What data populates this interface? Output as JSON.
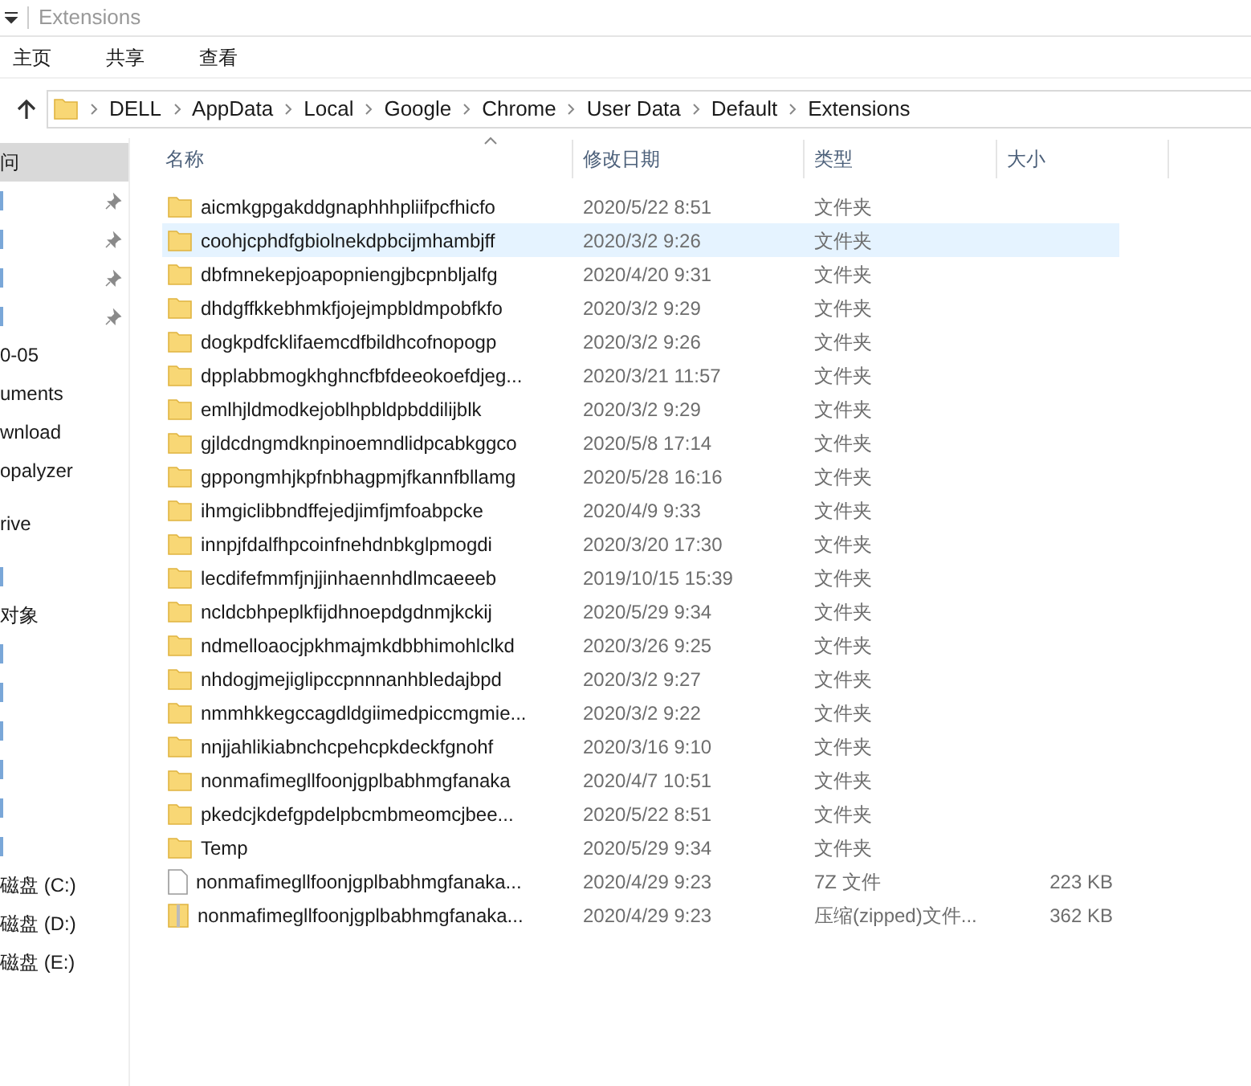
{
  "window": {
    "title": "Extensions"
  },
  "ribbon_tabs": [
    {
      "label": "主页",
      "selected": false
    },
    {
      "label": "共享",
      "selected": false
    },
    {
      "label": "查看",
      "selected": false
    }
  ],
  "address_bar": {
    "path": [
      "DELL",
      "AppData",
      "Local",
      "Google",
      "Chrome",
      "User Data",
      "Default",
      "Extensions"
    ]
  },
  "sidebar": {
    "items": [
      {
        "kind": "text",
        "label": "问",
        "selected": true,
        "pinned": false
      },
      {
        "kind": "fragment",
        "selected": false,
        "pinned": true
      },
      {
        "kind": "fragment",
        "selected": false,
        "pinned": true
      },
      {
        "kind": "fragment",
        "selected": false,
        "pinned": true
      },
      {
        "kind": "fragment",
        "selected": false,
        "pinned": true
      },
      {
        "kind": "text",
        "label": "0-05",
        "selected": false,
        "pinned": false
      },
      {
        "kind": "text",
        "label": "uments",
        "selected": false,
        "pinned": false
      },
      {
        "kind": "text",
        "label": "wnload",
        "selected": false,
        "pinned": false
      },
      {
        "kind": "text",
        "label": "opalyzer",
        "selected": false,
        "pinned": false
      },
      {
        "kind": "gap"
      },
      {
        "kind": "text",
        "label": "rive",
        "selected": false,
        "pinned": false
      },
      {
        "kind": "gap"
      },
      {
        "kind": "fragment",
        "selected": false,
        "pinned": false
      },
      {
        "kind": "text",
        "label": "对象",
        "selected": false,
        "pinned": false
      },
      {
        "kind": "fragment",
        "selected": false,
        "pinned": false
      },
      {
        "kind": "fragment",
        "selected": false,
        "pinned": false
      },
      {
        "kind": "fragment",
        "selected": false,
        "pinned": false
      },
      {
        "kind": "fragment",
        "selected": false,
        "pinned": false
      },
      {
        "kind": "fragment",
        "selected": false,
        "pinned": false
      },
      {
        "kind": "fragment",
        "selected": false,
        "pinned": false
      },
      {
        "kind": "text",
        "label": "磁盘 (C:)",
        "selected": false,
        "pinned": false
      },
      {
        "kind": "text",
        "label": "磁盘 (D:)",
        "selected": false,
        "pinned": false
      },
      {
        "kind": "text",
        "label": "磁盘 (E:)",
        "selected": false,
        "pinned": false
      }
    ]
  },
  "table": {
    "columns": [
      "名称",
      "修改日期",
      "类型",
      "大小"
    ],
    "rows": [
      {
        "kind": "folder",
        "name": "aicmkgpgakddgnaphhhpliifpcfhicfo",
        "date": "2020/5/22 8:51",
        "type": "文件夹",
        "selected": false
      },
      {
        "kind": "folder",
        "name": "coohjcphdfgbiolnekdpbcijmhambjff",
        "date": "2020/3/2 9:26",
        "type": "文件夹",
        "selected": true
      },
      {
        "kind": "folder",
        "name": "dbfmnekepjoapopniengjbcpnbljalfg",
        "date": "2020/4/20 9:31",
        "type": "文件夹",
        "selected": false
      },
      {
        "kind": "folder",
        "name": "dhdgffkkebhmkfjojejmpbldmpobfkfo",
        "date": "2020/3/2 9:29",
        "type": "文件夹",
        "selected": false
      },
      {
        "kind": "folder",
        "name": "dogkpdfcklifaemcdfbildhcofnopogp",
        "date": "2020/3/2 9:26",
        "type": "文件夹",
        "selected": false
      },
      {
        "kind": "folder",
        "name": "dpplabbmogkhghncfbfdeeokoefdjeg...",
        "date": "2020/3/21 11:57",
        "type": "文件夹",
        "selected": false
      },
      {
        "kind": "folder",
        "name": "emlhjldmodkejoblhpbldpbddilijblk",
        "date": "2020/3/2 9:29",
        "type": "文件夹",
        "selected": false
      },
      {
        "kind": "folder",
        "name": "gjldcdngmdknpinoemndlidpcabkggco",
        "date": "2020/5/8 17:14",
        "type": "文件夹",
        "selected": false
      },
      {
        "kind": "folder",
        "name": "gppongmhjkpfnbhagpmjfkannfbllamg",
        "date": "2020/5/28 16:16",
        "type": "文件夹",
        "selected": false
      },
      {
        "kind": "folder",
        "name": "ihmgiclibbndffejedjimfjmfoabpcke",
        "date": "2020/4/9 9:33",
        "type": "文件夹",
        "selected": false
      },
      {
        "kind": "folder",
        "name": "innpjfdalfhpcoinfnehdnbkglpmogdi",
        "date": "2020/3/20 17:30",
        "type": "文件夹",
        "selected": false
      },
      {
        "kind": "folder",
        "name": "lecdifefmmfjnjjinhaennhdlmcaeeeb",
        "date": "2019/10/15 15:39",
        "type": "文件夹",
        "selected": false
      },
      {
        "kind": "folder",
        "name": "ncldcbhpeplkfijdhnoepdgdnmjkckij",
        "date": "2020/5/29 9:34",
        "type": "文件夹",
        "selected": false
      },
      {
        "kind": "folder",
        "name": "ndmelloaocjpkhmajmkdbbhimohlclkd",
        "date": "2020/3/26 9:25",
        "type": "文件夹",
        "selected": false
      },
      {
        "kind": "folder",
        "name": "nhdogjmejiglipccpnnnanhbledajbpd",
        "date": "2020/3/2 9:27",
        "type": "文件夹",
        "selected": false
      },
      {
        "kind": "folder",
        "name": "nmmhkkegccagdldgiimedpiccmgmie...",
        "date": "2020/3/2 9:22",
        "type": "文件夹",
        "selected": false
      },
      {
        "kind": "folder",
        "name": "nnjjahlikiabnchcpehcpkdeckfgnohf",
        "date": "2020/3/16 9:10",
        "type": "文件夹",
        "selected": false
      },
      {
        "kind": "folder",
        "name": "nonmafimegllfoonjgplbabhmgfanaka",
        "date": "2020/4/7 10:51",
        "type": "文件夹",
        "selected": false
      },
      {
        "kind": "folder",
        "name": "pkedcjkdefgpdelpbcmbmeomcjbee...",
        "date": "2020/5/22 8:51",
        "type": "文件夹",
        "selected": false
      },
      {
        "kind": "folder",
        "name": "Temp",
        "date": "2020/5/29 9:34",
        "type": "文件夹",
        "selected": false
      },
      {
        "kind": "file",
        "name": "nonmafimegllfoonjgplbabhmgfanaka...",
        "date": "2020/4/29 9:23",
        "type": "7Z 文件",
        "size": "223 KB",
        "selected": false
      },
      {
        "kind": "zip",
        "name": "nonmafimegllfoonjgplbabhmgfanaka...",
        "date": "2020/4/29 9:23",
        "type": "压缩(zipped)文件...",
        "size": "362 KB",
        "selected": false
      }
    ]
  }
}
